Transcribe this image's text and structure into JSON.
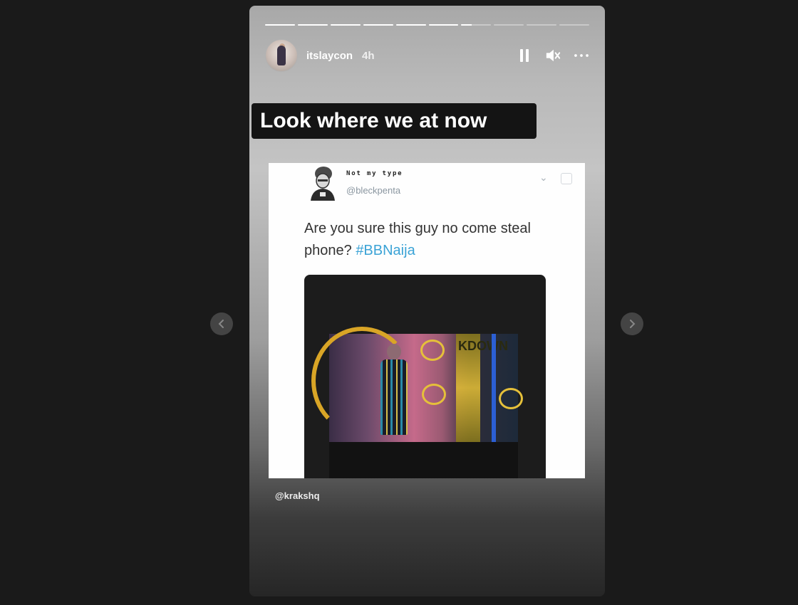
{
  "story": {
    "username": "itslaycon",
    "time_ago": "4h",
    "progress_segments": 10,
    "active_segment": 7,
    "active_segment_progress": 0.35,
    "caption": "Look where we at now",
    "credit": "@krakshq"
  },
  "tweet": {
    "display_name": "Not my type",
    "handle": "@bleckpenta",
    "text": "Are you sure this guy no come steal phone?",
    "hashtag": "#BBNaija",
    "media_text": "KDOWN"
  },
  "icons": {
    "pause": "pause-icon",
    "mute": "speaker-muted-icon",
    "more": "more-horizontal-icon",
    "prev": "chevron-left-icon",
    "next": "chevron-right-icon"
  },
  "colors": {
    "background": "#1a1a1a",
    "hashtag": "#3ba3d6",
    "caption_bg": "#141414"
  }
}
